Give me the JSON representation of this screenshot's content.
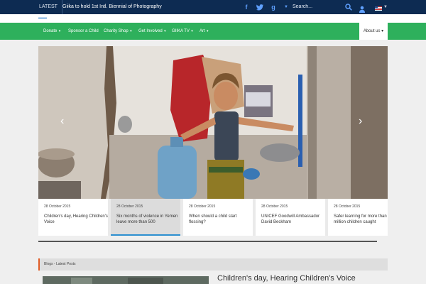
{
  "topbar": {
    "latest_label": "LATEST",
    "headline": "Giika to hold 1st Intl. Biennial of Photography",
    "search_placeholder": "Search...",
    "social": [
      {
        "icon": "facebook-icon",
        "glyph": "f"
      },
      {
        "icon": "twitter-icon",
        "glyph": "t"
      },
      {
        "icon": "google-plus-icon",
        "glyph": "g"
      },
      {
        "icon": "chevron-down-icon",
        "glyph": "▼"
      }
    ]
  },
  "nav": {
    "items": [
      {
        "label": "Donate",
        "dropdown": true
      },
      {
        "label": "Sponsor a Child",
        "dropdown": false
      },
      {
        "label": "Charity Shop",
        "dropdown": true
      },
      {
        "label": "Get Involved",
        "dropdown": true
      },
      {
        "label": "GIIKA TV",
        "dropdown": true
      },
      {
        "label": "Art",
        "dropdown": true
      }
    ],
    "about": "About us"
  },
  "slider": {
    "prev": "‹",
    "next": "›",
    "cards": [
      {
        "date": "28 October 2015",
        "title": "Children's day, Hearing Children's Voice",
        "active": false
      },
      {
        "date": "28 October 2015",
        "title": "Six months of violence in Yemen leave more than 500",
        "active": true
      },
      {
        "date": "28 October 2015",
        "title": "When should a child start flossing?",
        "active": false
      },
      {
        "date": "28 October 2015",
        "title": "UNICEF Goodwill Ambassador David Beckham",
        "active": false
      },
      {
        "date": "28 October 2015",
        "title": "Safer learning for more than 3 million children caught",
        "active": false
      }
    ]
  },
  "blog": {
    "heading": "Blogs - Latest Posts",
    "first_title": "Children's day, Hearing Children's Voice"
  },
  "colors": {
    "topbar": "#0d2b52",
    "nav": "#2eb05c",
    "accent_blue": "#2c8fd0",
    "accent_orange": "#e05b25"
  }
}
